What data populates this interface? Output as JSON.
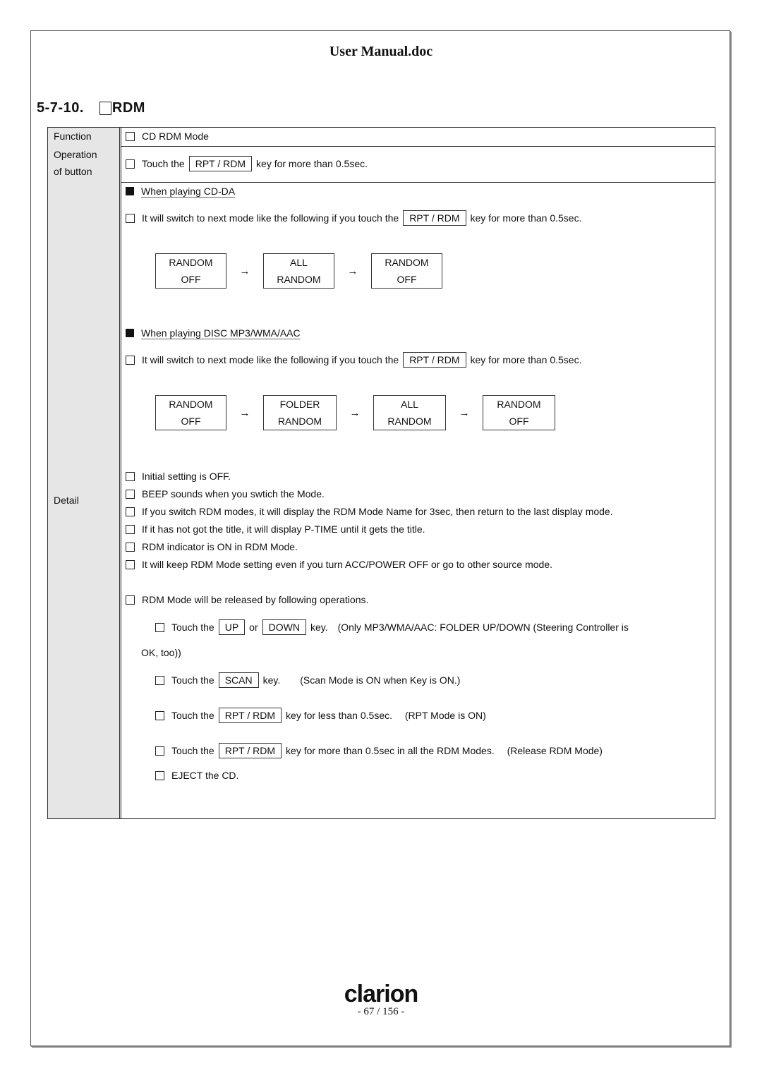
{
  "document": {
    "title": "User Manual.doc",
    "section_number": "5-7-10.",
    "section_title": "RDM"
  },
  "table": {
    "function_label": "Function",
    "function_value": "CD RDM Mode",
    "operation_label_1": "Operation",
    "operation_label_2": "of button",
    "operation": {
      "pre": "Touch the",
      "key": "RPT / RDM",
      "post": "key for more than 0.5sec."
    },
    "detail_label": "Detail",
    "cdda": {
      "heading": "When playing CD-DA",
      "instruction": {
        "pre": "It will switch to next mode like the following if you touch the",
        "key": "RPT / RDM",
        "post": "key for more than 0.5sec."
      },
      "flow": [
        {
          "line1": "RANDOM",
          "line2": "OFF"
        },
        {
          "line1": "ALL",
          "line2": "RANDOM"
        },
        {
          "line1": "RANDOM",
          "line2": "OFF"
        }
      ],
      "arrow": "→"
    },
    "mp3": {
      "heading": "When playing DISC MP3/WMA/AAC",
      "instruction": {
        "pre": "It will switch to next mode like the following if you touch the",
        "key": "RPT / RDM",
        "post": "key for more than 0.5sec."
      },
      "flow": [
        {
          "line1": "RANDOM",
          "line2": "OFF"
        },
        {
          "line1": "FOLDER",
          "line2": "RANDOM"
        },
        {
          "line1": "ALL",
          "line2": "RANDOM"
        },
        {
          "line1": "RANDOM",
          "line2": "OFF"
        }
      ],
      "arrow": "→"
    },
    "notes": [
      "Initial setting is OFF.",
      "BEEP sounds when you swtich the Mode.",
      "If you switch RDM modes, it will display the RDM Mode Name for 3sec, then return to the last display mode.",
      "If it has not got the title, it will display P-TIME until it gets the title.",
      "RDM indicator is ON in RDM Mode.",
      "It will keep RDM Mode setting even if you turn ACC/POWER OFF or go to other source mode."
    ],
    "release_heading": "RDM Mode will be released by following operations.",
    "release": {
      "up_down": {
        "pre": "Touch the",
        "key1": "UP",
        "mid": "or",
        "key2": "DOWN",
        "post": "key.　(Only MP3/WMA/AAC:  FOLDER UP/DOWN  (Steering Controller is",
        "cont": "OK, too))"
      },
      "scan": {
        "pre": "Touch the",
        "key": "SCAN",
        "post": "key.　　(Scan Mode is ON when Key is ON.)"
      },
      "rpt_short": {
        "pre": "Touch the",
        "key": "RPT / RDM",
        "post": "key for less than 0.5sec.　 (RPT Mode is ON)"
      },
      "rpt_long": {
        "pre": "Touch the",
        "key": "RPT / RDM",
        "post": "key for more than 0.5sec in all the RDM Modes.　 (Release RDM Mode)"
      },
      "eject": "EJECT the CD."
    }
  },
  "footer": {
    "brand": "clarion",
    "page": "- 67 / 156 -"
  }
}
